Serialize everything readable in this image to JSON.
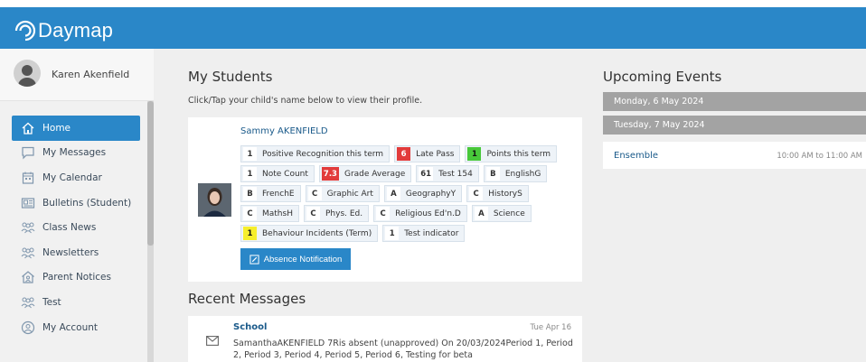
{
  "app": {
    "name": "Daymap"
  },
  "user": {
    "name": "Karen Akenfield"
  },
  "sidebar": {
    "items": [
      {
        "label": "Home",
        "icon": "home-icon",
        "active": true
      },
      {
        "label": "My Messages",
        "icon": "message-icon"
      },
      {
        "label": "My Calendar",
        "icon": "calendar-icon"
      },
      {
        "label": "Bulletins (Student)",
        "icon": "bulletin-icon"
      },
      {
        "label": "Class News",
        "icon": "people-icon"
      },
      {
        "label": "Newsletters",
        "icon": "people-icon"
      },
      {
        "label": "Parent Notices",
        "icon": "house-people-icon"
      },
      {
        "label": "Test",
        "icon": "people-icon"
      },
      {
        "label": "My Account",
        "icon": "account-icon"
      }
    ]
  },
  "students": {
    "title": "My Students",
    "subtitle": "Click/Tap your child's name below to view their profile.",
    "student": {
      "name": "Sammy AKENFIELD",
      "rows": [
        [
          {
            "value": "1",
            "label": "Positive Recognition this term",
            "style": "plain"
          },
          {
            "value": "6",
            "label": "Late Pass",
            "style": "red"
          },
          {
            "value": "1",
            "label": "Points this term",
            "style": "green"
          }
        ],
        [
          {
            "value": "1",
            "label": "Note Count",
            "style": "plain"
          },
          {
            "value": "7.3",
            "label": "Grade Average",
            "style": "red"
          },
          {
            "value": "61",
            "label": "Test 154",
            "style": "plain"
          },
          {
            "value": "B",
            "label": "EnglishG",
            "style": "plain"
          }
        ],
        [
          {
            "value": "B",
            "label": "FrenchE",
            "style": "plain"
          },
          {
            "value": "C",
            "label": "Graphic Art",
            "style": "plain"
          },
          {
            "value": "A",
            "label": "GeographyY",
            "style": "plain"
          },
          {
            "value": "C",
            "label": "HistoryS",
            "style": "plain"
          }
        ],
        [
          {
            "value": "C",
            "label": "MathsH",
            "style": "plain"
          },
          {
            "value": "C",
            "label": "Phys. Ed.",
            "style": "plain"
          },
          {
            "value": "C",
            "label": "Religious Ed'n.D",
            "style": "plain"
          },
          {
            "value": "A",
            "label": "Science",
            "style": "plain"
          }
        ],
        [
          {
            "value": "1",
            "label": "Behaviour Incidents (Term)",
            "style": "yellow"
          },
          {
            "value": "1",
            "label": "Test indicator",
            "style": "plain"
          }
        ]
      ],
      "absence_button": "Absence Notification"
    }
  },
  "messages": {
    "title": "Recent Messages",
    "items": [
      {
        "from": "School",
        "date": "Tue Apr 16",
        "body": "SamanthaAKENFIELD 7Ris absent (unapproved) On 20/03/2024Period 1, Period 2, Period 3, Period 4, Period 5, Period 6, Testing for beta"
      }
    ]
  },
  "events": {
    "title": "Upcoming Events",
    "days": [
      {
        "label": "Monday, 6 May 2024"
      },
      {
        "label": "Tuesday, 7 May 2024"
      }
    ],
    "items": [
      {
        "name": "Ensemble",
        "time": "10:00 AM to 11:00 AM"
      }
    ]
  },
  "colors": {
    "brand": "#2a87c8",
    "red_badge": "#e23b3b",
    "green_badge": "#48c83a",
    "yellow_badge": "#f6ee2c"
  }
}
